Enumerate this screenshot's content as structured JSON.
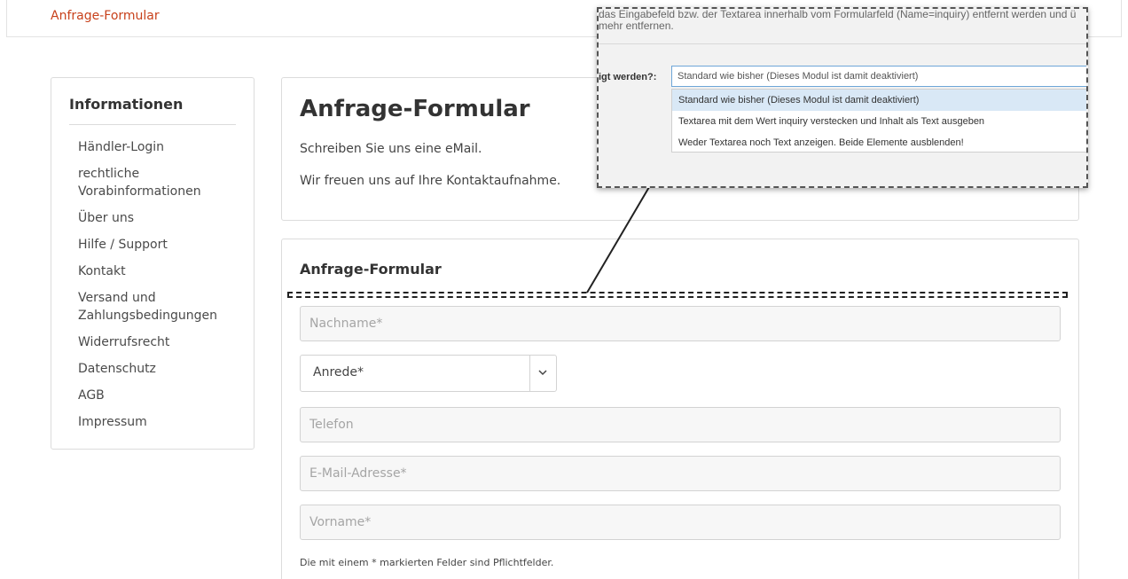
{
  "breadcrumb": "Anfrage-Formular",
  "sidebar": {
    "title": "Informationen",
    "items": [
      "Händler-Login",
      "rechtliche Vorabinformationen",
      "Über uns",
      "Hilfe / Support",
      "Kontakt",
      "Versand und Zahlungsbedingungen",
      "Widerrufsrecht",
      "Datenschutz",
      "AGB",
      "Impressum"
    ]
  },
  "intro": {
    "title": "Anfrage-Formular",
    "line1": "Schreiben Sie uns eine eMail.",
    "line2": "Wir freuen uns auf Ihre Kontaktaufnahme."
  },
  "form": {
    "title": "Anfrage-Formular",
    "nachname_placeholder": "Nachname*",
    "anrede_value": "Anrede*",
    "telefon_placeholder": "Telefon",
    "email_placeholder": "E-Mail-Adresse*",
    "vorname_placeholder": "Vorname*",
    "required_note": "Die mit einem * markierten Felder sind Pflichtfelder."
  },
  "popup": {
    "text_line1": "das Eingabefeld bzw. der Textarea innerhalb vom Formularfeld (Name=inquiry) entfernt werden und ü",
    "text_line2": "mehr entfernen.",
    "label": "igt werden?:",
    "selected": "Standard wie bisher (Dieses Modul ist damit deaktiviert)",
    "options": [
      "Standard wie bisher (Dieses Modul ist damit deaktiviert)",
      "Textarea mit dem Wert inquiry verstecken und Inhalt als Text ausgeben",
      "Weder Textarea noch Text anzeigen. Beide Elemente ausblenden!"
    ]
  },
  "colors": {
    "accent": "#c8411b",
    "highlight": "#d9e8f6"
  }
}
